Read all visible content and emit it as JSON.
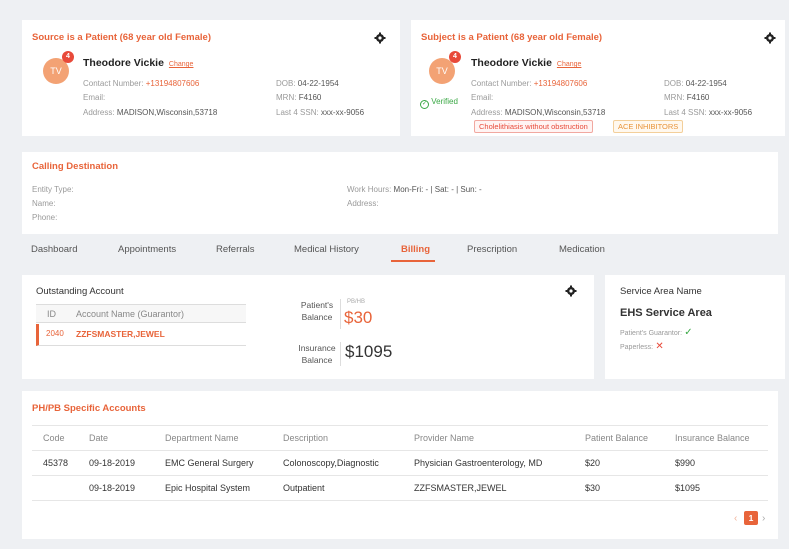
{
  "source": {
    "title": "Source is a Patient (68 year old Female)",
    "avatar": "TV",
    "badge": "4",
    "name": "Theodore Vickie",
    "change": "Change",
    "contact_label": "Contact Number:",
    "contact_value": "+13194807606",
    "email_label": "Email:",
    "email_value": "",
    "address_label": "Address:",
    "address_value": "MADISON,Wisconsin,53718",
    "dob_label": "DOB:",
    "dob_value": "04-22-1954",
    "mrn_label": "MRN:",
    "mrn_value": "F4160",
    "ssn_label": "Last 4 SSN:",
    "ssn_value": "xxx-xx-9056"
  },
  "subject": {
    "title": "Subject is a Patient (68 year old Female)",
    "avatar": "TV",
    "badge": "4",
    "verified": "Verified",
    "name": "Theodore Vickie",
    "change": "Change",
    "contact_label": "Contact Number:",
    "contact_value": "+13194807606",
    "email_label": "Email:",
    "email_value": "",
    "address_label": "Address:",
    "address_value": "MADISON,Wisconsin,53718",
    "dob_label": "DOB:",
    "dob_value": "04-22-1954",
    "mrn_label": "MRN:",
    "mrn_value": "F4160",
    "ssn_label": "Last 4 SSN:",
    "ssn_value": "xxx-xx-9056",
    "tag1": "Cholelithiasis without obstruction",
    "tag2": "ACE INHIBITORS"
  },
  "calling": {
    "title": "Calling Destination",
    "entity_type": "Entity Type:",
    "name": "Name:",
    "phone": "Phone:",
    "work_hours_label": "Work Hours:",
    "work_hours_value": "Mon-Fri: - | Sat: - | Sun: -",
    "address": "Address:"
  },
  "tabs": [
    "Dashboard",
    "Appointments",
    "Referrals",
    "Medical History",
    "Billing",
    "Prescription",
    "Medication"
  ],
  "outstanding": {
    "title": "Outstanding Account",
    "col_id": "ID",
    "col_name": "Account Name (Guarantor)",
    "row_id": "2040",
    "row_name": "ZZFSMASTER,JEWEL",
    "patients_balance_label": "Patient's Balance",
    "pb_hb": "PB/HB",
    "patients_balance": "$30",
    "insurance_balance_label": "Insurance Balance",
    "insurance_balance": "$1095"
  },
  "service_area": {
    "title": "Service Area Name",
    "name": "EHS Service Area",
    "guarantor_label": "Patient's Guarantor:",
    "paperless_label": "Paperless:"
  },
  "phpb": {
    "title": "PH/PB Specific Accounts",
    "headers": [
      "Code",
      "Date",
      "Department Name",
      "Description",
      "Provider Name",
      "Patient Balance",
      "Insurance Balance"
    ],
    "rows": [
      [
        "45378",
        "09-18-2019",
        "EMC General Surgery",
        "Colonoscopy,Diagnostic",
        "Physician Gastroenterology, MD",
        "$20",
        "$990"
      ],
      [
        "",
        "09-18-2019",
        "Epic Hospital System",
        "Outpatient",
        "ZZFSMASTER,JEWEL",
        "$30",
        "$1095"
      ]
    ],
    "page": "1"
  },
  "colors": {
    "accent": "#e8643a",
    "verified": "#3aa845",
    "danger": "#e84a3a"
  },
  "icons": [
    "gear-icon",
    "check-circle-icon",
    "check-icon",
    "x-icon",
    "chevron-left-icon",
    "chevron-right-icon"
  ]
}
